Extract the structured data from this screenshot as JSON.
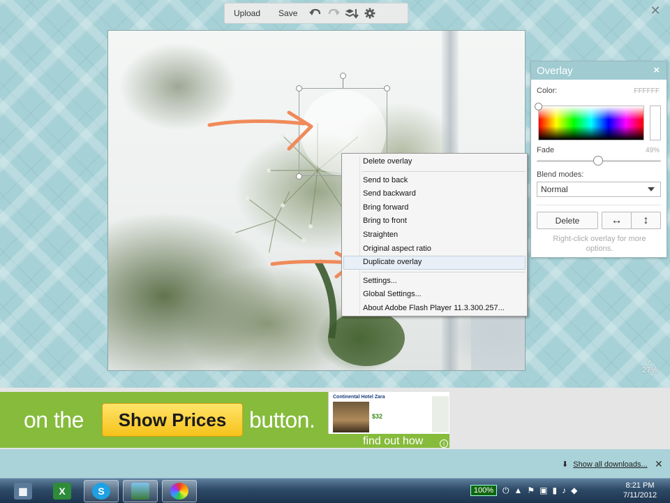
{
  "toolbar": {
    "upload_label": "Upload",
    "save_label": "Save",
    "icons": [
      "undo-icon",
      "redo-icon",
      "layers-sort-icon",
      "gear-icon"
    ]
  },
  "app_close_glyph": "✕",
  "context_menu": {
    "items_group1": [
      "Delete overlay"
    ],
    "items_group2": [
      "Send to back",
      "Send backward",
      "Bring forward",
      "Bring to front",
      "Straighten",
      "Original aspect ratio",
      "Duplicate overlay"
    ],
    "items_group3": [
      "Settings...",
      "Global Settings...",
      "About Adobe Flash Player 11.3.300.257..."
    ],
    "highlighted_item": "Duplicate overlay"
  },
  "panel": {
    "title": "Overlay",
    "close_glyph": "×",
    "color_label": "Color:",
    "color_value": "FFFFFF",
    "fade_label": "Fade",
    "fade_value": "49%",
    "fade_fraction": 0.49,
    "blend_label": "Blend modes:",
    "blend_value": "Normal",
    "delete_label": "Delete",
    "flip_h_glyph": "↔",
    "flip_v_glyph": "↕",
    "hint": "Right-click overlay for more options."
  },
  "zoom": {
    "caret": "^",
    "value": "27%"
  },
  "ad": {
    "text_left": "on the",
    "button_label": "Show Prices",
    "text_right": "button.",
    "hotel_name": "Continental Hotel Zara",
    "price": "$32",
    "find_out": "find out how",
    "info_glyph": "i"
  },
  "downloads": {
    "link": "Show all downloads...",
    "close_glyph": "✕"
  },
  "taskbar": {
    "battery": "100%",
    "time": "8:21 PM",
    "date": "7/11/2012",
    "colors": {
      "accent": "#a0cbd1",
      "ad_green": "#86bb3c",
      "ad_button": "#f6c21a",
      "arrow": "#f08a5a"
    }
  }
}
